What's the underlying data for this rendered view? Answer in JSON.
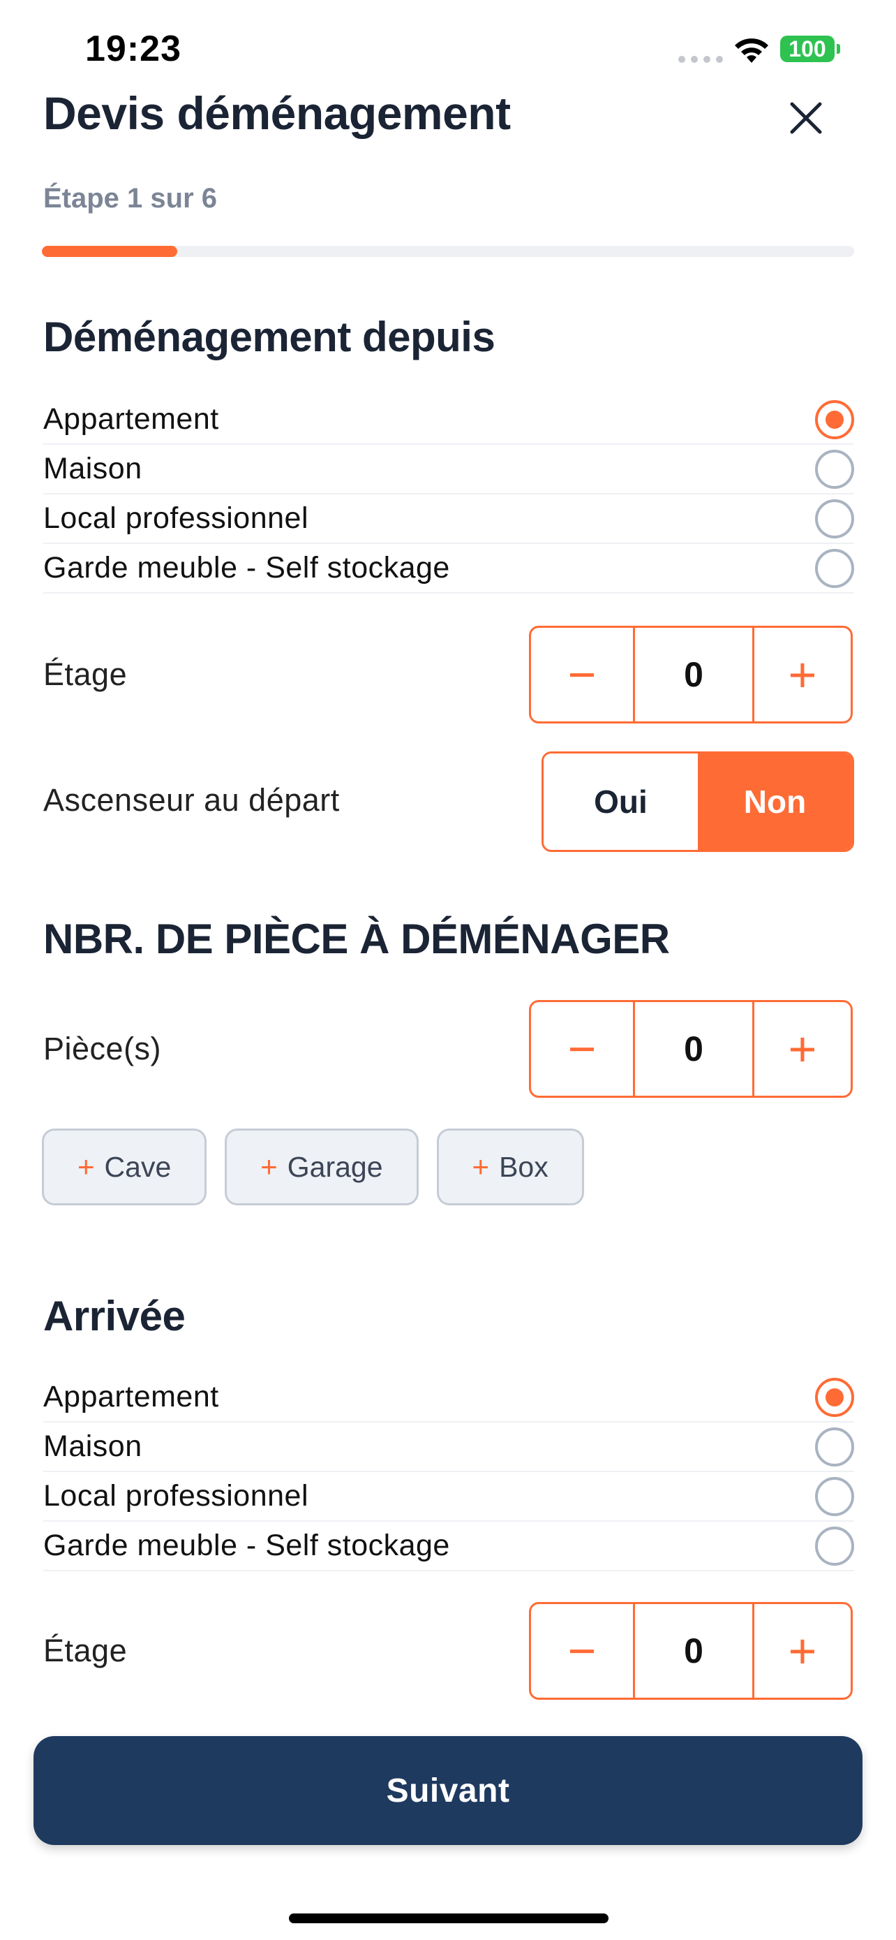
{
  "status_bar": {
    "time": "19:23",
    "battery": "100"
  },
  "header": {
    "title": "Devis déménagement",
    "step_label": "Étape 1 sur 6",
    "progress_fraction": 0.1667
  },
  "departure": {
    "title": "Déménagement depuis",
    "options": [
      {
        "label": "Appartement",
        "selected": true
      },
      {
        "label": "Maison",
        "selected": false
      },
      {
        "label": "Local professionnel",
        "selected": false
      },
      {
        "label": "Garde meuble - Self stockage",
        "selected": false
      }
    ],
    "floor_label": "Étage",
    "floor_value": "0",
    "elevator_label": "Ascenseur au départ",
    "elevator_yes": "Oui",
    "elevator_no": "Non",
    "elevator_selected": "Non"
  },
  "rooms": {
    "title": "NBR. DE PIÈCE À DÉMÉNAGER",
    "label": "Pièce(s)",
    "value": "0",
    "extras": [
      "Cave",
      "Garage",
      "Box"
    ]
  },
  "arrival": {
    "title": "Arrivée",
    "options": [
      {
        "label": "Appartement",
        "selected": true
      },
      {
        "label": "Maison",
        "selected": false
      },
      {
        "label": "Local professionnel",
        "selected": false
      },
      {
        "label": "Garde meuble - Self stockage",
        "selected": false
      }
    ],
    "floor_label": "Étage",
    "floor_value": "0"
  },
  "stepper_symbols": {
    "minus": "−",
    "plus": "+"
  },
  "footer": {
    "next_label": "Suivant"
  },
  "colors": {
    "accent": "#ff6b35",
    "primary_button": "#1f3a5f",
    "text_dark": "#1b2434",
    "muted": "#7b8595",
    "battery": "#2ec251"
  }
}
